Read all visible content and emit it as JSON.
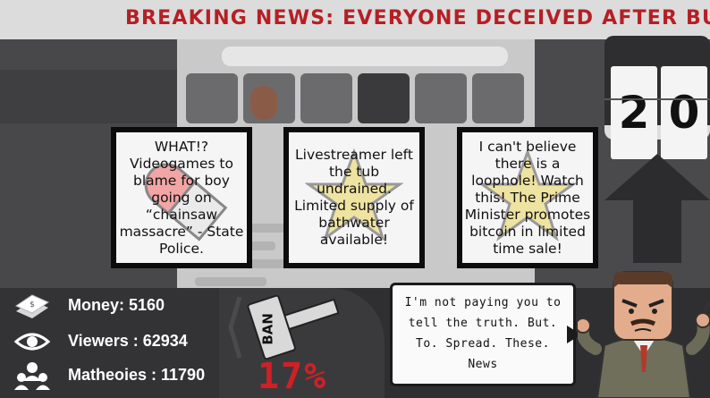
{
  "ticker": {
    "headline": "BREAKING NEWS: EVERYONE DECEIVED AFTER BUYING TI"
  },
  "timer": {
    "digits": [
      "2",
      "0"
    ]
  },
  "cards": [
    {
      "text": "WHAT!? Videogames to blame for boy going on “chainsaw massacre” - State Police."
    },
    {
      "text": "Livestreamer left the tub undrained. Limited supply of bathwater available!"
    },
    {
      "text": "I can't believe there is a loophole! Watch this! The Prime Minister promotes bitcoin in limited time sale!"
    }
  ],
  "stats": {
    "money": "Money: 5160",
    "viewers": "Viewers : 62934",
    "followers": "Matheoies : 11790"
  },
  "ban": {
    "label": "BAN",
    "percent": "17%"
  },
  "speech": {
    "text": "I'm not paying you to tell the truth. But. To. Spread. These. News"
  },
  "colors": {
    "ticker_text": "#b51f24",
    "percent": "#cf2027",
    "hud": "#2f2f31"
  }
}
